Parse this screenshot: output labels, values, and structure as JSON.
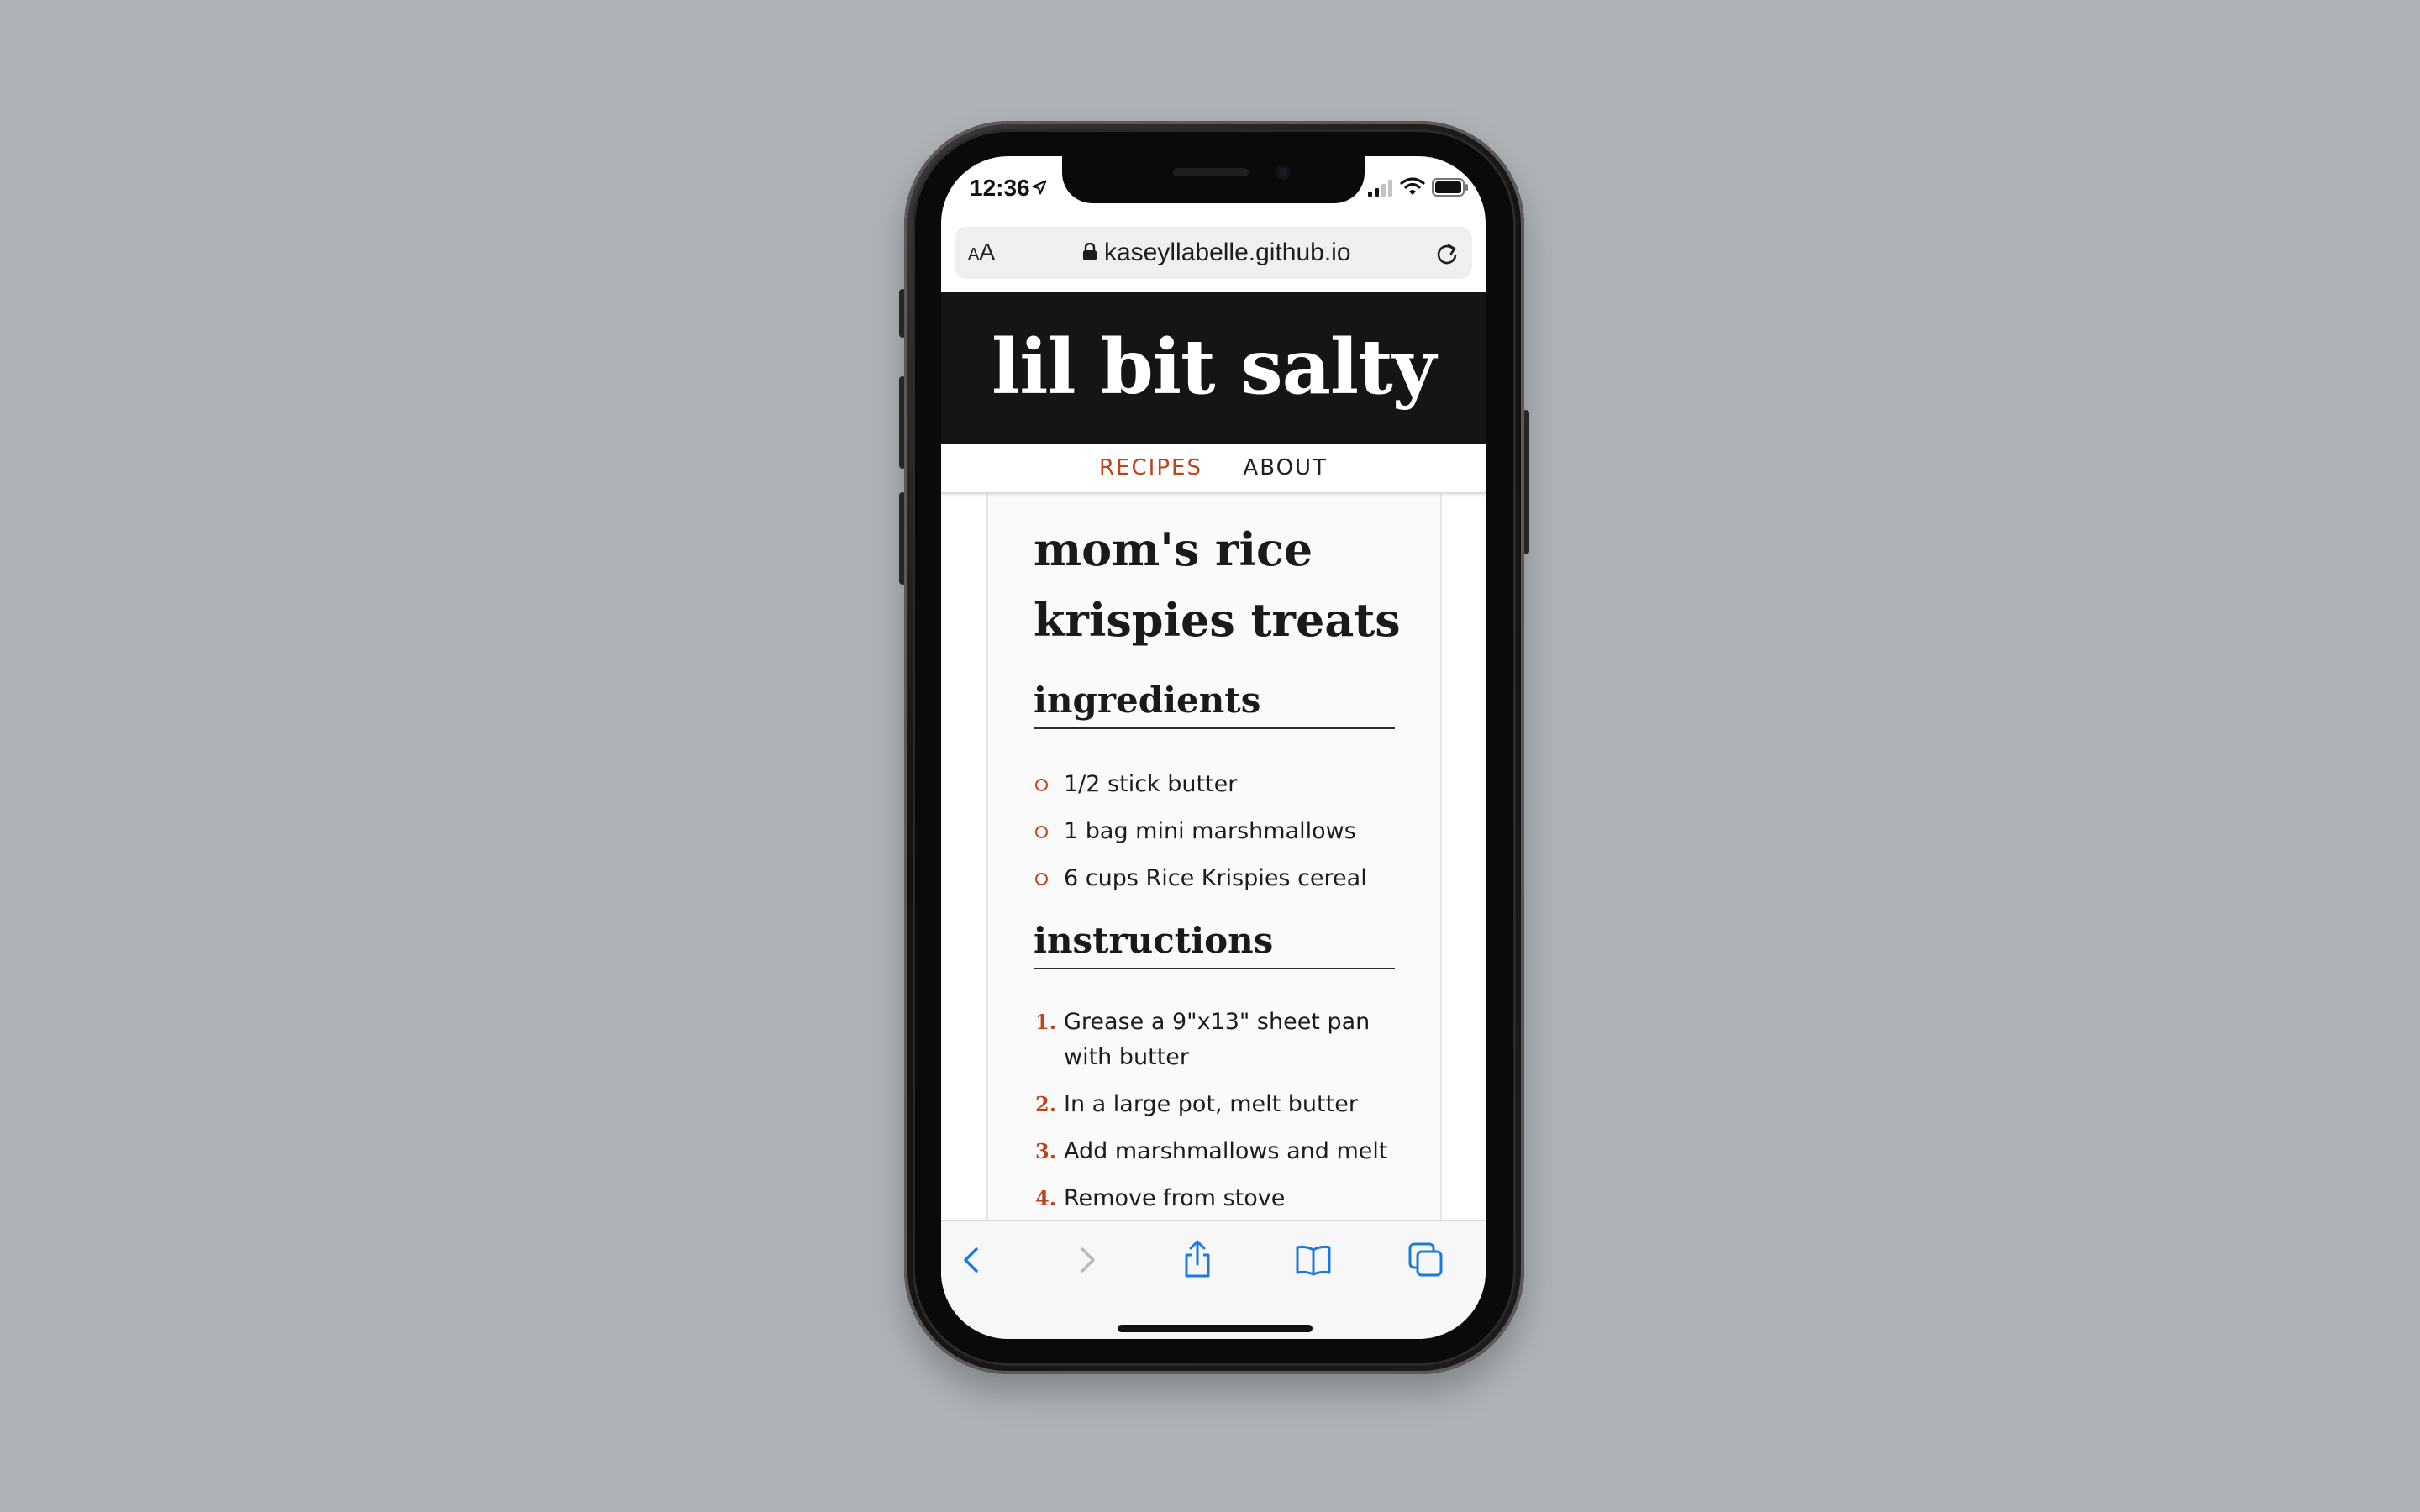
{
  "status_bar": {
    "time": "12:36"
  },
  "browser": {
    "aa_small": "A",
    "aa_large": "A",
    "url": "kaseyllabelle.github.io"
  },
  "site": {
    "title": "lil bit salty",
    "nav": [
      {
        "label": "RECIPES",
        "active": true
      },
      {
        "label": "ABOUT",
        "active": false
      }
    ]
  },
  "recipe": {
    "title": "mom's rice krispies treats",
    "ingredients_heading": "ingredients",
    "ingredients": [
      "1/2 stick butter",
      "1 bag mini marshmallows",
      "6 cups Rice Krispies cereal"
    ],
    "instructions_heading": "instructions",
    "steps": [
      {
        "num": "1.",
        "text": "Grease a 9\"x13\" sheet pan with butter"
      },
      {
        "num": "2.",
        "text": "In a large pot, melt butter"
      },
      {
        "num": "3.",
        "text": "Add marshmallows and melt"
      },
      {
        "num": "4.",
        "text": "Remove from stove"
      }
    ]
  },
  "colors": {
    "accent": "#c0441b",
    "header_bg": "#151515",
    "ios_blue": "#1a7ae0"
  },
  "icons": {
    "location": "location-arrow-icon",
    "signal": "cellular-signal-icon",
    "wifi": "wifi-icon",
    "battery": "battery-icon",
    "lock": "lock-icon",
    "reload": "reload-icon",
    "back": "chevron-left-icon",
    "forward": "chevron-right-icon",
    "share": "share-icon",
    "bookmarks": "book-icon",
    "tabs": "tabs-icon"
  }
}
